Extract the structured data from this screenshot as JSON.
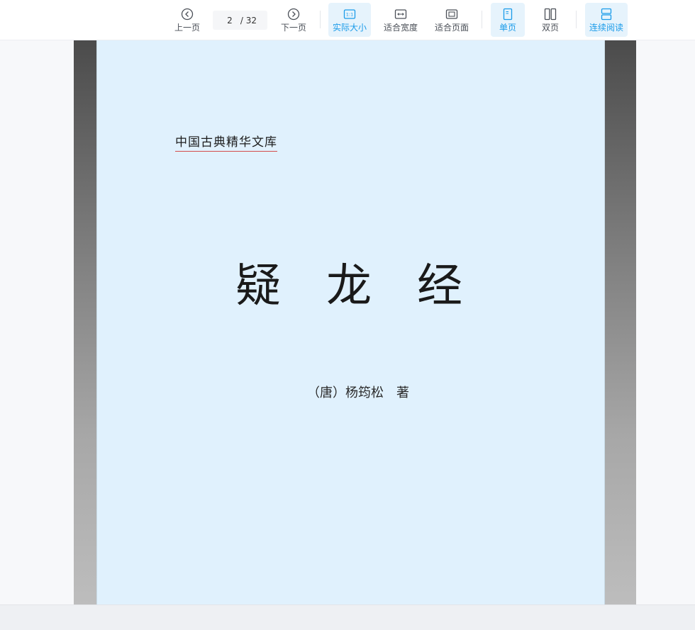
{
  "toolbar": {
    "prev_label": "上一页",
    "next_label": "下一页",
    "page": {
      "current": "2",
      "total": "/ 32"
    },
    "actual_size_label": "实际大小",
    "fit_width_label": "适合宽度",
    "fit_page_label": "适合页面",
    "single_page_label": "单页",
    "double_page_label": "双页",
    "continuous_label": "连续阅读",
    "icons": {
      "prev": "chevron-left-circle-icon",
      "next": "chevron-right-circle-icon",
      "actual_size": "actual-size-icon",
      "fit_width": "fit-width-icon",
      "fit_page": "fit-page-icon",
      "single_page": "single-page-icon",
      "double_page": "double-page-icon",
      "continuous": "continuous-scroll-icon"
    },
    "active": [
      "actual_size",
      "single_page",
      "continuous"
    ]
  },
  "document": {
    "series": "中国古典精华文库",
    "title": "疑龙经",
    "author": "（唐）杨筠松　著"
  },
  "colors": {
    "accent": "#1a9be9",
    "active_bg": "#e6f3fc",
    "paper": "#e0f1fd",
    "underline": "#d44b4b"
  }
}
